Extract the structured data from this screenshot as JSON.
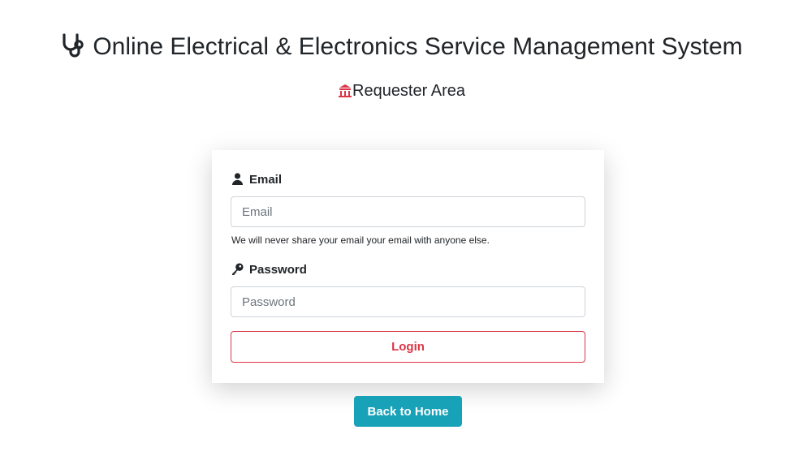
{
  "header": {
    "title": "Online Electrical & Electronics Service Management System",
    "title_icon": "stethoscope-icon",
    "subtitle": "Requester Area",
    "subtitle_icon": "temple-icon",
    "subtitle_icon_color": "#dc3545"
  },
  "form": {
    "email_label": "Email",
    "email_icon": "user-icon",
    "email_placeholder": "Email",
    "email_value": "",
    "email_help": "We will never share your email your email with anyone else.",
    "password_label": "Password",
    "password_icon": "key-icon",
    "password_placeholder": "Password",
    "password_value": "",
    "login_label": "Login"
  },
  "back_home_label": "Back to Home",
  "colors": {
    "danger": "#dc3545",
    "info": "#17a2b8"
  }
}
